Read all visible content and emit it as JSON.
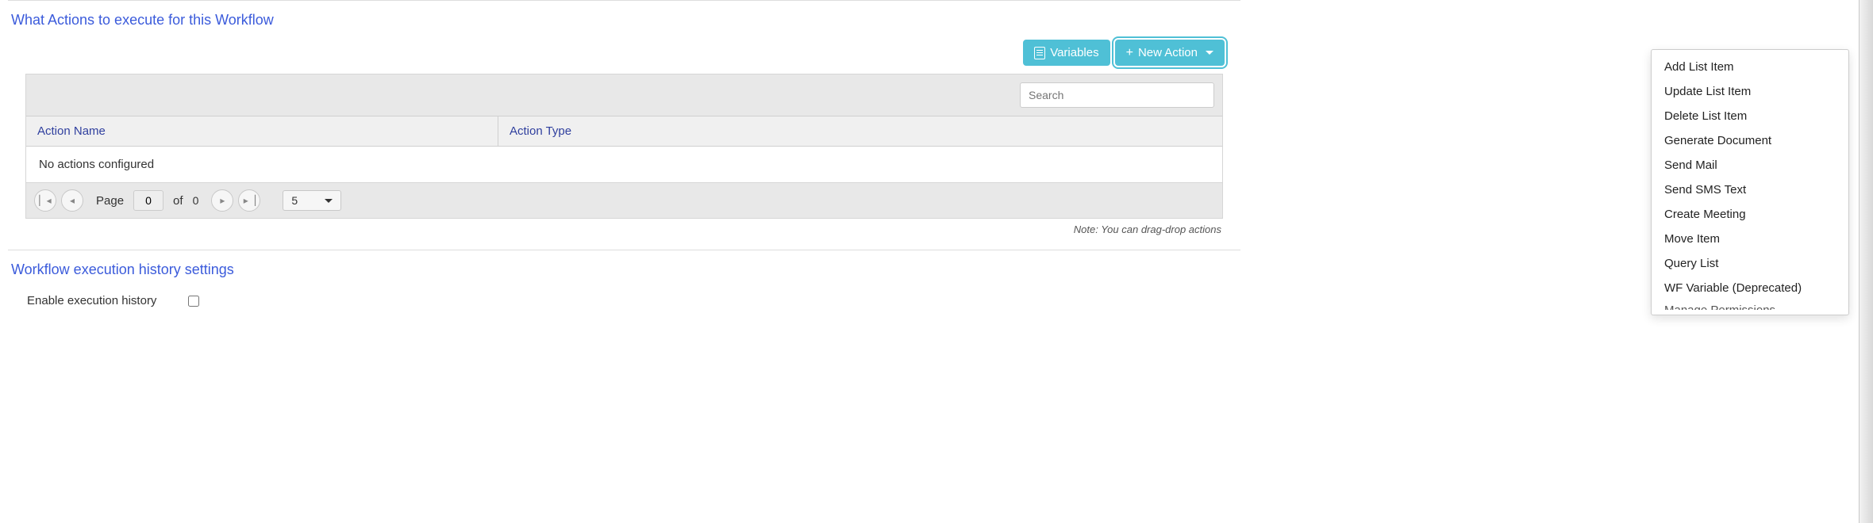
{
  "section_actions_title": "What Actions to execute for this Workflow",
  "toolbar": {
    "variables_label": "Variables",
    "new_action_label": "New Action"
  },
  "grid": {
    "search_placeholder": "Search",
    "columns": {
      "action_name": "Action Name",
      "action_type": "Action Type"
    },
    "empty_text": "No actions configured",
    "pager": {
      "page_label": "Page",
      "current": "0",
      "of_label": "of",
      "total": "0",
      "page_size": "5"
    }
  },
  "note": "Note: You can drag-drop actions",
  "section_history_title": "Workflow execution history settings",
  "history": {
    "enable_label": "Enable execution history"
  },
  "dropdown_items": [
    "Add List Item",
    "Update List Item",
    "Delete List Item",
    "Generate Document",
    "Send Mail",
    "Send SMS Text",
    "Create Meeting",
    "Move Item",
    "Query List",
    "WF Variable (Deprecated)",
    "Manage Permissions"
  ]
}
